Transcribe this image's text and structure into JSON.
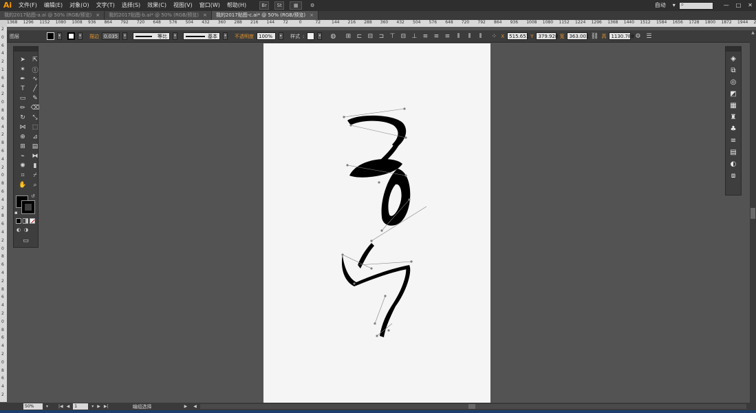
{
  "app": {
    "logo": "Ai"
  },
  "menu": {
    "items": [
      "文件(F)",
      "编辑(E)",
      "对象(O)",
      "文字(T)",
      "选择(S)",
      "效果(C)",
      "视图(V)",
      "窗口(W)",
      "帮助(H)"
    ],
    "workspace": "自动",
    "bridge_label": "Br",
    "stock_label": "St",
    "win_min": "—",
    "win_max": "□",
    "win_close": "✕"
  },
  "tabs": [
    {
      "label": "我的2017贴图-a.ai @ 50% (RGB/预览)"
    },
    {
      "label": "我的2017贴图-b.ai* @ 50% (RGB/预览)"
    },
    {
      "label": "我的2017贴图-c.ai* @ 50% (RGB/预览)"
    }
  ],
  "ruler_top": [
    "1368",
    "1296",
    "1152",
    "1080",
    "1008",
    "936",
    "864",
    "792",
    "720",
    "648",
    "576",
    "504",
    "432",
    "360",
    "288",
    "216",
    "144",
    "72",
    "0",
    "72",
    "144",
    "216",
    "288",
    "360",
    "432",
    "504",
    "576",
    "648",
    "720",
    "792",
    "864",
    "936",
    "1008",
    "1080",
    "1152",
    "1224",
    "1296",
    "1368",
    "1440",
    "1512",
    "1584",
    "1656",
    "1728",
    "1800",
    "1872",
    "1944",
    "2016",
    "2088",
    "2160",
    "2232"
  ],
  "ruler_left": [
    "2",
    "0",
    "6",
    "4",
    "2",
    "1",
    "6",
    "4",
    "2",
    "0",
    "8",
    "6",
    "4",
    "2",
    "8",
    "6",
    "4",
    "2",
    "0",
    "8",
    "6",
    "4",
    "2",
    "8",
    "6",
    "4",
    "2",
    "0",
    "8",
    "6",
    "4",
    "2",
    "8",
    "6",
    "4",
    "2",
    "0",
    "8",
    "6",
    "4",
    "2",
    "0",
    "8",
    "6",
    "4",
    "2"
  ],
  "control_bar": {
    "selection_type": "图层",
    "stroke_label": "描边",
    "stroke_value": "0.035",
    "stroke_profile": "等比",
    "brush": "基本",
    "opacity_label": "不透明度",
    "opacity_value": "100%",
    "style_label": "样式",
    "x_label": "X",
    "x_value": "515.651",
    "y_label": "Y",
    "y_value": "379.928",
    "w_label": "宽",
    "w_value": "363.001",
    "h_label": "高",
    "h_value": "1130.788"
  },
  "colors": {
    "fill": "#000000",
    "stroke": "#000000",
    "accent_orange": "#e0922c",
    "artboard": "#f5f5f5",
    "pasteboard": "#535353",
    "path_handles": "#808080"
  },
  "tools": [
    "selection-tool-icon",
    "direct-selection-tool-icon",
    "magic-wand-tool-icon",
    "lasso-tool-icon",
    "pen-tool-icon",
    "curvature-tool-icon",
    "type-tool-icon",
    "line-segment-tool-icon",
    "rectangle-tool-icon",
    "paintbrush-tool-icon",
    "pencil-tool-icon",
    "eraser-tool-icon",
    "rotate-tool-icon",
    "scale-tool-icon",
    "width-tool-icon",
    "free-transform-tool-icon",
    "shape-builder-tool-icon",
    "perspective-grid-tool-icon",
    "mesh-tool-icon",
    "gradient-tool-icon",
    "eyedropper-tool-icon",
    "blend-tool-icon",
    "symbol-sprayer-tool-icon",
    "column-graph-tool-icon",
    "artboard-tool-icon",
    "slice-tool-icon",
    "hand-tool-icon",
    "zoom-tool-icon"
  ],
  "status": {
    "zoom": "50%",
    "page": "1",
    "mode": "编组选择"
  }
}
